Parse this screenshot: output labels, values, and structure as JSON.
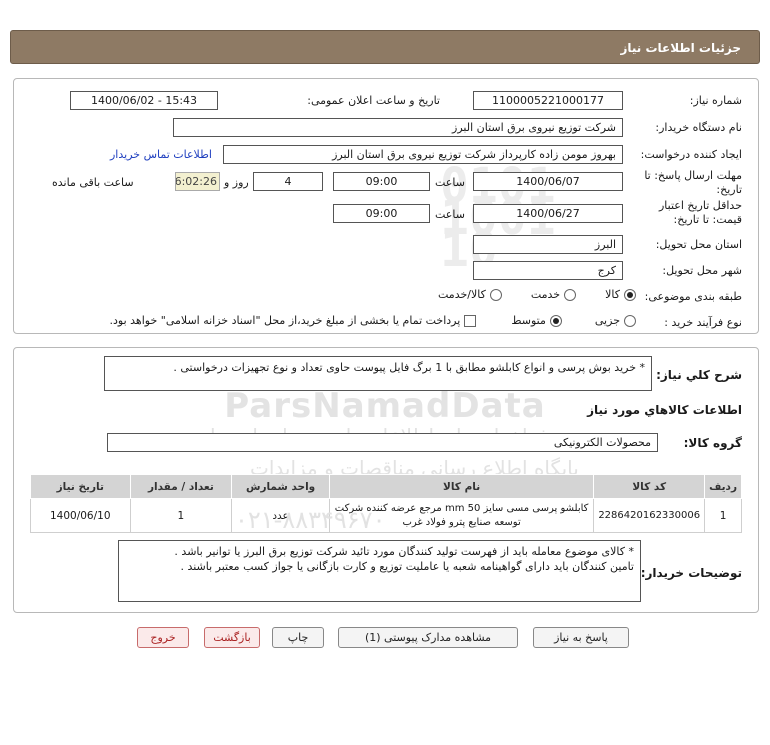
{
  "header": {
    "title": "جزئیات اطلاعات نیاز"
  },
  "form": {
    "need_number_label": "شماره نیاز:",
    "need_number": "1100005221000177",
    "announce_label": "تاریخ و ساعت اعلان عمومی:",
    "announce_value": "1400/06/02 - 15:43",
    "buyer_org_label": "نام دستگاه خریدار:",
    "buyer_org": "شرکت توزیع نیروی برق استان البرز",
    "creator_label": "ایجاد کننده درخواست:",
    "creator": "بهروز مومن زاده کارپرداز شرکت توزیع نیروی برق استان البرز",
    "contact_link": "اطلاعات تماس خریدار",
    "deadline_label_1": "مهلت ارسال پاسخ: تا",
    "deadline_label_2": "تاریخ:",
    "deadline_date": "1400/06/07",
    "time_label": "ساعت",
    "deadline_time": "09:00",
    "days_value": "4",
    "days_label": "روز و",
    "remaining_timer": "16:02:26",
    "remaining_label": "ساعت باقی مانده",
    "validity_label_1": "حداقل تاریخ اعتبار",
    "validity_label_2": "قیمت: تا تاریخ:",
    "validity_date": "1400/06/27",
    "validity_time": "09:00",
    "province_label": "استان محل تحویل:",
    "province": "البرز",
    "city_label": "شهر محل تحویل:",
    "city": "کرج",
    "category_label": "طبقه بندی موضوعی:",
    "category_options": {
      "goods": "کالا",
      "service": "خدمت",
      "goods_service": "کالا/خدمت"
    },
    "process_label": "نوع فرآیند خرید :",
    "process_options": {
      "minor": "جزیی",
      "medium": "متوسط"
    },
    "payment_note": "پرداخت تمام یا بخشی از مبلغ خرید،از محل \"اسناد خزانه اسلامی\" خواهد بود."
  },
  "description": {
    "label": "شرح کلي نياز:",
    "text": "* خرید بوش پرسی و انواع کابلشو مطابق با 1 برگ فایل پیوست حاوی تعداد و نوع تجهیزات درخواستی ."
  },
  "goods": {
    "section_title": "اطلاعات کالاهاي مورد نياز",
    "group_label": "گروه کالا:",
    "group_value": "محصولات الکترونیکی",
    "columns": {
      "row": "ردیف",
      "code": "کد کالا",
      "name": "نام کالا",
      "unit": "واحد شمارش",
      "qty": "تعداد / مقدار",
      "date": "تاریخ نیاز"
    },
    "rows": [
      {
        "row": "1",
        "code": "2286420162330006",
        "name": "کابلشو پرسی مسی سایز 50 mm مرجع عرضه کننده شرکت توسعه صنایع پترو فولاد غرب",
        "unit": "عدد",
        "qty": "1",
        "date": "1400/06/10"
      }
    ]
  },
  "buyer_notes": {
    "label": "توضیحات خریدار:",
    "line1": "* کالای موضوع معامله باید از فهرست تولید کنندگان مورد تائید شرکت توزیع برق البرز یا توانیر باشد .",
    "line2": "تامین کنندگان باید دارای گواهینامه شعبه یا عاملیت توزیع و کارت بازگانی یا جواز کسب معتبر باشند ."
  },
  "buttons": {
    "reply": "پاسخ به نیاز",
    "attachments": "مشاهده مدارک پیوستی (1)",
    "print": "چاپ",
    "back": "بازگشت",
    "exit": "خروج"
  },
  "watermark": {
    "brand": "ParsNamadData",
    "line1": "پایگاه اطلاع رسانی مناقصات و مزایدات",
    "line2": "فراخوان های اطلاعات پارس نماد داده ها",
    "phone": "۰۲۱-۸۸۳۴۹۶۷۰"
  },
  "colors": {
    "titlebar": "#8e7a64",
    "link": "#1f3fbf",
    "exit": "#aa2222",
    "timer_bg": "#f3f0d0"
  }
}
